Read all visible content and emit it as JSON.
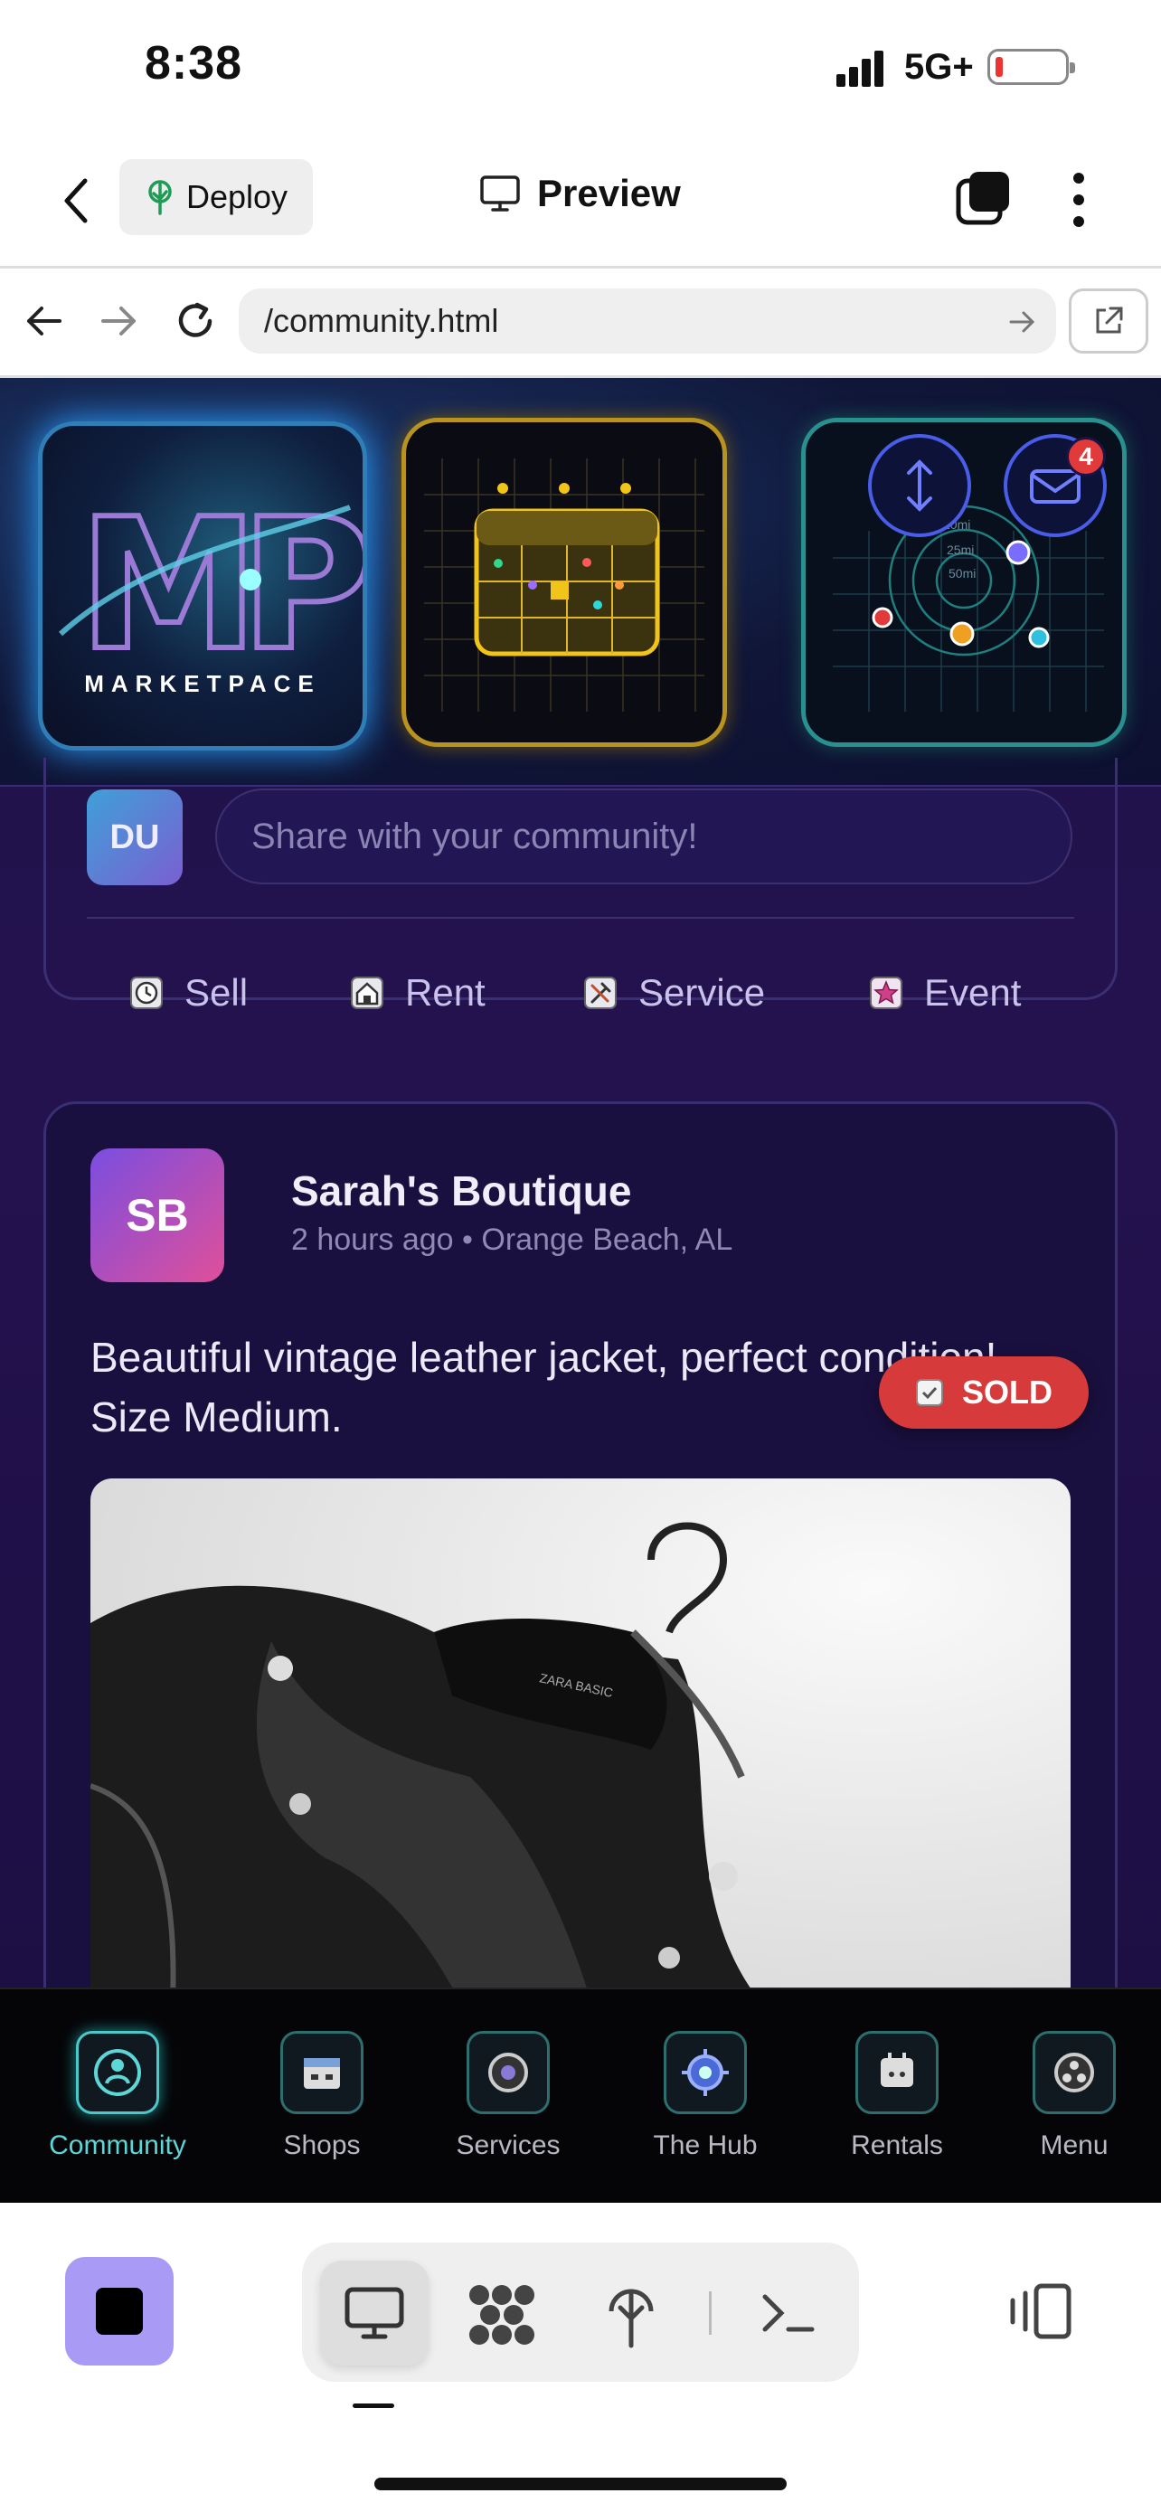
{
  "status_bar": {
    "time": "8:38",
    "network": "5G+"
  },
  "app_bar": {
    "deploy_label": "Deploy",
    "preview_label": "Preview"
  },
  "browser": {
    "url": "/community.html"
  },
  "hero": {
    "logo_text": "MARKETPACE",
    "logo_letters": "MP",
    "notification_count": "4",
    "radar_labels": [
      "10mi",
      "25mi",
      "50mi"
    ]
  },
  "composer": {
    "avatar_initials": "DU",
    "placeholder": "Share with your community!",
    "actions": [
      {
        "label": "Sell",
        "icon": "clock-icon"
      },
      {
        "label": "Rent",
        "icon": "home-icon"
      },
      {
        "label": "Service",
        "icon": "tools-icon"
      },
      {
        "label": "Event",
        "icon": "star-icon"
      }
    ]
  },
  "post": {
    "avatar_initials": "SB",
    "author": "Sarah's Boutique",
    "meta": "2 hours ago • Orange Beach, AL",
    "text": "Beautiful vintage leather jacket, perfect condition! Size Medium.",
    "badge": "SOLD",
    "image_label": "ZARA BASIC"
  },
  "tabs": [
    {
      "label": "Community",
      "icon": "community-icon",
      "active": true
    },
    {
      "label": "Shops",
      "icon": "shop-icon",
      "active": false
    },
    {
      "label": "Services",
      "icon": "services-icon",
      "active": false
    },
    {
      "label": "The Hub",
      "icon": "hub-icon",
      "active": false
    },
    {
      "label": "Rentals",
      "icon": "rentals-icon",
      "active": false
    },
    {
      "label": "Menu",
      "icon": "menu-icon",
      "active": false
    }
  ],
  "colors": {
    "accent": "#5cd6d6",
    "sold": "#d73a3a",
    "background": "#1b1245",
    "stop_button": "#a99bf5"
  }
}
